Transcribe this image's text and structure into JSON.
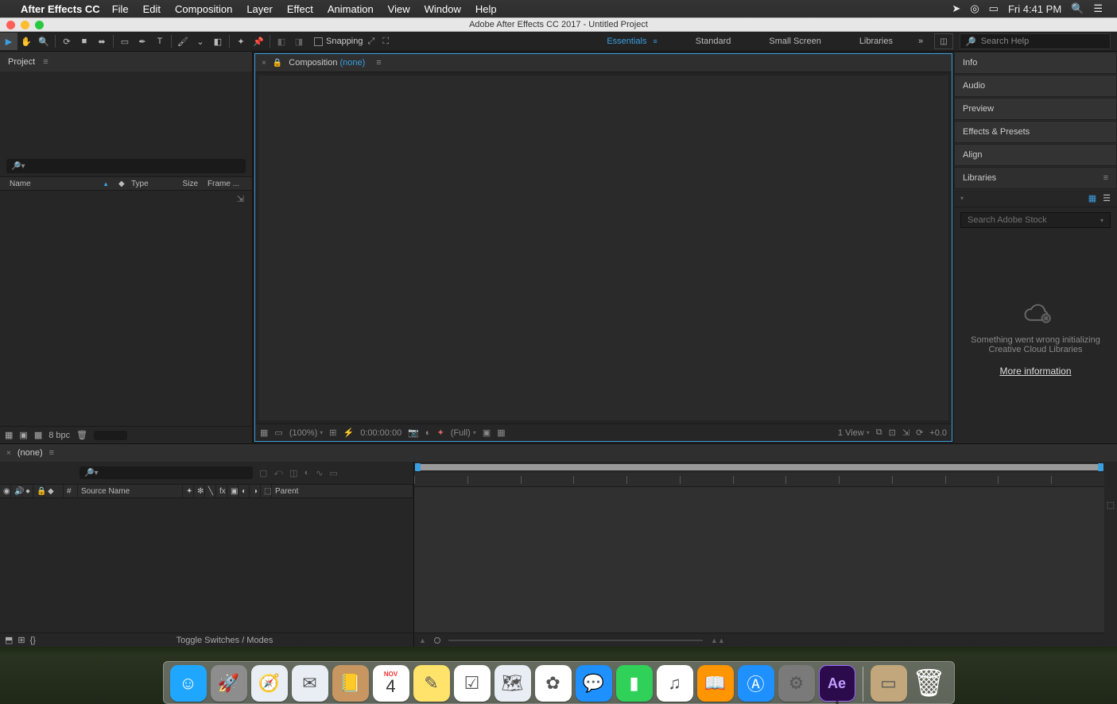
{
  "mac_menubar": {
    "app_name": "After Effects CC",
    "items": [
      "File",
      "Edit",
      "Composition",
      "Layer",
      "Effect",
      "Animation",
      "View",
      "Window",
      "Help"
    ],
    "clock": "Fri 4:41 PM"
  },
  "window": {
    "title": "Adobe After Effects CC 2017 - Untitled Project"
  },
  "toolbar": {
    "snapping_label": "Snapping",
    "workspaces": [
      "Essentials",
      "Standard",
      "Small Screen",
      "Libraries"
    ],
    "active_workspace_index": 0,
    "search_placeholder": "Search Help"
  },
  "project": {
    "tab_label": "Project",
    "columns": [
      "Name",
      "Type",
      "Size",
      "Frame ..."
    ],
    "bpc": "8 bpc"
  },
  "composition_panel": {
    "tab_prefix": "Composition",
    "comp_name": "(none)",
    "footer": {
      "zoom": "(100%)",
      "timecode": "0:00:00:00",
      "resolution": "(Full)",
      "view_count": "1 View",
      "exposure": "+0.0"
    }
  },
  "right_panels": {
    "items": [
      "Info",
      "Audio",
      "Preview",
      "Effects & Presets",
      "Align",
      "Libraries"
    ],
    "active_index": 5,
    "libraries": {
      "search_placeholder": "Search Adobe Stock",
      "error_line1": "Something went wrong initializing",
      "error_line2": "Creative Cloud Libraries",
      "more_info": "More information"
    }
  },
  "timeline": {
    "tab_name": "(none)",
    "layer_header": {
      "number": "#",
      "source": "Source Name",
      "parent": "Parent"
    },
    "toggle_label": "Toggle Switches / Modes"
  },
  "dock": {
    "items": [
      {
        "name": "finder",
        "bg": "#1fa7ff",
        "glyph": "☺"
      },
      {
        "name": "launchpad",
        "bg": "#8d8d8d",
        "glyph": "🚀"
      },
      {
        "name": "safari",
        "bg": "#e8eef4",
        "glyph": "🧭"
      },
      {
        "name": "mail",
        "bg": "#e8eef4",
        "glyph": "✉"
      },
      {
        "name": "contacts",
        "bg": "#c89660",
        "glyph": "📒"
      },
      {
        "name": "calendar",
        "bg": "#ffffff",
        "glyph": "4",
        "top": "NOV"
      },
      {
        "name": "notes",
        "bg": "#ffe36b",
        "glyph": "✎"
      },
      {
        "name": "reminders",
        "bg": "#ffffff",
        "glyph": "☑"
      },
      {
        "name": "maps",
        "bg": "#e8eef4",
        "glyph": "🗺"
      },
      {
        "name": "photos",
        "bg": "#ffffff",
        "glyph": "✿"
      },
      {
        "name": "messages",
        "bg": "#1e90ff",
        "glyph": "💬"
      },
      {
        "name": "facetime",
        "bg": "#30d158",
        "glyph": "▮"
      },
      {
        "name": "itunes",
        "bg": "#ffffff",
        "glyph": "♫"
      },
      {
        "name": "ibooks",
        "bg": "#ff9500",
        "glyph": "📖"
      },
      {
        "name": "appstore",
        "bg": "#1e90ff",
        "glyph": "Ⓐ"
      },
      {
        "name": "preferences",
        "bg": "#7a7a7a",
        "glyph": "⚙"
      },
      {
        "name": "aftereffects",
        "bg": "#2b0b4b",
        "glyph": "Ae",
        "running": true
      }
    ],
    "right_items": [
      {
        "name": "desktop-image",
        "bg": "#c2a77d",
        "glyph": "▭"
      },
      {
        "name": "trash",
        "bg": "transparent",
        "glyph": "🗑"
      }
    ]
  }
}
